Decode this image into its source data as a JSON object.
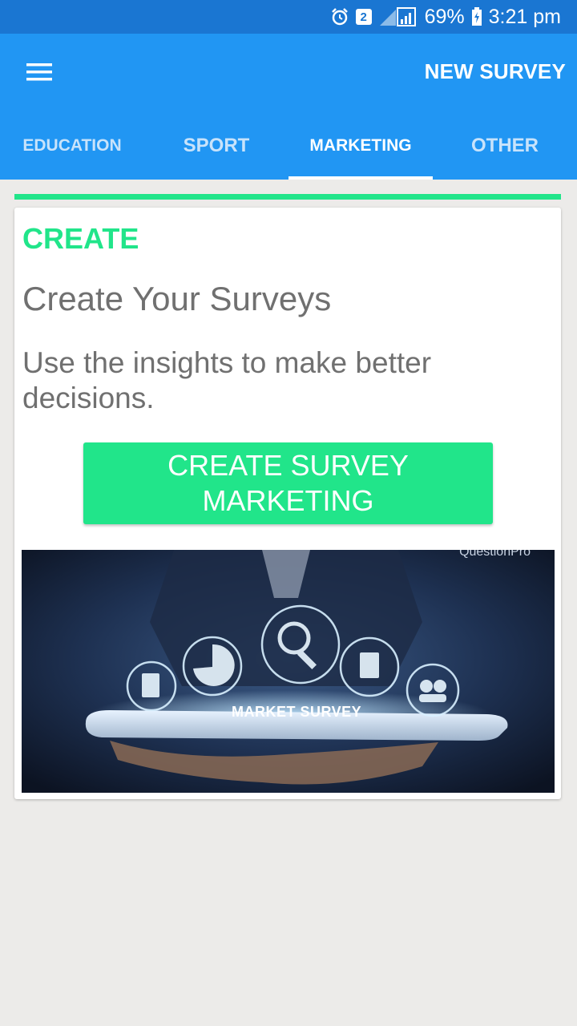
{
  "status_bar": {
    "badge": "2",
    "battery": "69%",
    "time": "3:21 pm",
    "icons": [
      "alarm-icon",
      "notification-badge",
      "signal-icon",
      "battery-icon"
    ]
  },
  "app_bar": {
    "action": "NEW SURVEY",
    "menu_icon": "hamburger-menu-icon"
  },
  "tabs": [
    {
      "label": "EDUCATION",
      "active": false
    },
    {
      "label": "SPORT",
      "active": false
    },
    {
      "label": "MARKETING",
      "active": true
    },
    {
      "label": "OTHER",
      "active": false
    }
  ],
  "card": {
    "kicker": "CREATE",
    "title": "Create Your Surveys",
    "text": "Use the insights to make better decisions.",
    "button": "CREATE SURVEY MARKETING"
  },
  "hero_image": {
    "label": "MARKET SURVEY",
    "watermark": "QuestionPro"
  },
  "colors": {
    "status_bar": "#1a76d2",
    "app_bar": "#2196f3",
    "accent": "#21e58a",
    "background": "#ecebe9",
    "text": "#707070"
  }
}
